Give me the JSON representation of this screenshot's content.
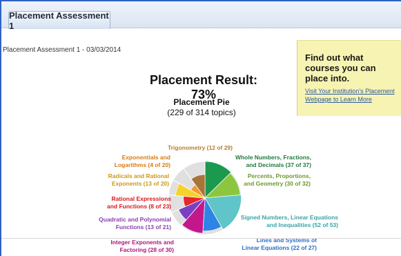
{
  "tabs": [
    {
      "label": "Placement Assessment 1"
    }
  ],
  "subtitle": "Placement Assessment 1 - 03/03/2014",
  "result": {
    "title": "Placement Result: 73%"
  },
  "pie": {
    "title": "Placement Pie",
    "count": "(229 of 314 topics)"
  },
  "promo": {
    "heading": "Find out what courses you can place into.",
    "link": "Visit Your Institution's Placement Webpage to Learn More"
  },
  "chart_data": {
    "type": "pie",
    "title": "Placement Pie",
    "subtitle": "(229 of 314 topics)",
    "slices": [
      {
        "name": "Whole Numbers, Fractions, and Decimals",
        "label1": "Whole Numbers, Fractions,",
        "label2": "and Decimals (37 of 37)",
        "mastered": 37,
        "total": 37,
        "color": "#1b9a4f",
        "text_color": "#1f7a3e"
      },
      {
        "name": "Percents, Proportions, and Geometry",
        "label1": "Percents, Proportions,",
        "label2": "and Geometry (30 of 32)",
        "mastered": 30,
        "total": 32,
        "color": "#8cc63f",
        "text_color": "#6a9a2a"
      },
      {
        "name": "Signed Numbers, Linear Equations and Inequalities",
        "label1": "Signed Numbers, Linear Equations",
        "label2": "and Inequalities (52 of 53)",
        "mastered": 52,
        "total": 53,
        "color": "#5fc5c9",
        "text_color": "#3aa3a8"
      },
      {
        "name": "Lines and Systems of Linear Equations",
        "label1": "Lines and Systems of",
        "label2": "Linear Equations (22 of 27)",
        "mastered": 22,
        "total": 27,
        "color": "#2d84e6",
        "text_color": "#2a6dc4"
      },
      {
        "name": "Integer Exponents and Factoring",
        "label1": "Integer Exponents and",
        "label2": "Factoring (28 of 30)",
        "mastered": 28,
        "total": 30,
        "color": "#c2188c",
        "text_color": "#b0157d"
      },
      {
        "name": "Quadratic and Polynomial Functions",
        "label1": "Quadratic and Polynomial",
        "label2": "Functions (13 of 21)",
        "mastered": 13,
        "total": 21,
        "color": "#7b3fc4",
        "text_color": "#8a3fb0"
      },
      {
        "name": "Rational Expressions and Functions",
        "label1": "Rational Expressions",
        "label2": "and Functions (8 of 23)",
        "mastered": 8,
        "total": 23,
        "color": "#e8262a",
        "text_color": "#d8161c"
      },
      {
        "name": "Radicals and Rational Exponents",
        "label1": "Radicals and Rational",
        "label2": "Exponents (13 of 20)",
        "mastered": 13,
        "total": 20,
        "color": "#f5d32c",
        "text_color": "#c99a16"
      },
      {
        "name": "Exponentials and Logarithms",
        "label1": "Exponentials and",
        "label2": "Logarithms (4 of 20)",
        "mastered": 4,
        "total": 20,
        "color": "#f29a2e",
        "text_color": "#d77b13"
      },
      {
        "name": "Trigonometry",
        "label1": "Trigonometry (12 of 29)",
        "label2": "",
        "mastered": 12,
        "total": 29,
        "color": "#a8743a",
        "text_color": "#b77d2c"
      }
    ],
    "outer_ring_color": "#e0e0e0",
    "legend": "none"
  }
}
